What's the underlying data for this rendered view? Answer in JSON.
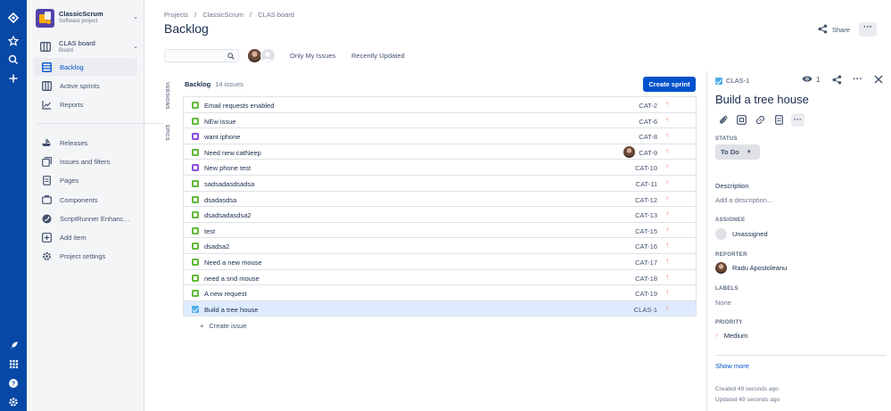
{
  "sidebar": {
    "project_name": "ClassicScrum",
    "project_type": "Software project",
    "board_name": "CLAS board",
    "board_sub": "Board",
    "items": [
      {
        "label": "Backlog",
        "icon": "backlog-icon"
      },
      {
        "label": "Active sprints",
        "icon": "board-icon"
      },
      {
        "label": "Reports",
        "icon": "reports-icon"
      },
      {
        "label": "Releases",
        "icon": "ship-icon"
      },
      {
        "label": "Issues and filters",
        "icon": "issues-icon"
      },
      {
        "label": "Pages",
        "icon": "page-icon"
      },
      {
        "label": "Components",
        "icon": "component-icon"
      },
      {
        "label": "ScriptRunner Enhanc…",
        "icon": "scriptrunner-icon"
      },
      {
        "label": "Add item",
        "icon": "add-item-icon"
      },
      {
        "label": "Project settings",
        "icon": "settings-icon"
      }
    ]
  },
  "breadcrumb": {
    "projects": "Projects",
    "project": "ClassicScrum",
    "board": "CLAS board"
  },
  "page_title": "Backlog",
  "filters": {
    "only_my_issues": "Only My Issues",
    "recently_updated": "Recently Updated"
  },
  "side_tabs": {
    "versions": "VERSIONS",
    "epics": "EPICS"
  },
  "backlog": {
    "title": "Backlog",
    "count": "14 issues",
    "create_sprint": "Create sprint",
    "create_issue": "Create issue",
    "issues": [
      {
        "summary": "Email requests enabled",
        "key": "CAT-2",
        "type": "story"
      },
      {
        "summary": "NEw issue",
        "key": "CAT-6",
        "type": "story"
      },
      {
        "summary": "want iphone",
        "key": "CAT-8",
        "type": "epic"
      },
      {
        "summary": "Need new catNeep",
        "key": "CAT-9",
        "type": "story",
        "assignee": true
      },
      {
        "summary": "New phone test",
        "key": "CAT-10",
        "type": "epic"
      },
      {
        "summary": "sadsadasdsadsa",
        "key": "CAT-11",
        "type": "story"
      },
      {
        "summary": "dsadasdsa",
        "key": "CAT-12",
        "type": "story"
      },
      {
        "summary": "dsadsadasdsa2",
        "key": "CAT-13",
        "type": "story"
      },
      {
        "summary": "test",
        "key": "CAT-15",
        "type": "story"
      },
      {
        "summary": "dsadsa2",
        "key": "CAT-16",
        "type": "story"
      },
      {
        "summary": "Need a new mouse",
        "key": "CAT-17",
        "type": "story"
      },
      {
        "summary": "need a snd mouse",
        "key": "CAT-18",
        "type": "story"
      },
      {
        "summary": "A new request",
        "key": "CAT-19",
        "type": "story"
      },
      {
        "summary": "Build a tree house",
        "key": "CLAS-1",
        "type": "task",
        "selected": true
      }
    ]
  },
  "header_actions": {
    "share": "Share"
  },
  "detail": {
    "key": "CLAS-1",
    "watchers": "1",
    "title": "Build a tree house",
    "status_label": "STATUS",
    "status": "To Do",
    "description_label": "Description",
    "description_placeholder": "Add a description...",
    "assignee_label": "ASSIGNEE",
    "assignee": "Unassigned",
    "reporter_label": "REPORTER",
    "reporter": "Radu Apostoleanu",
    "labels_label": "LABELS",
    "labels": "None",
    "priority_label": "PRIORITY",
    "priority": "Medium",
    "show_more": "Show more",
    "created": "Created 49 seconds ago",
    "updated": "Updated 49 seconds ago"
  },
  "colors": {
    "nav": "#0747a6",
    "primary": "#0052cc",
    "story": "#63ba3c",
    "epic": "#904ee2",
    "task": "#4bade8",
    "priority_medium": "#ff7452"
  }
}
